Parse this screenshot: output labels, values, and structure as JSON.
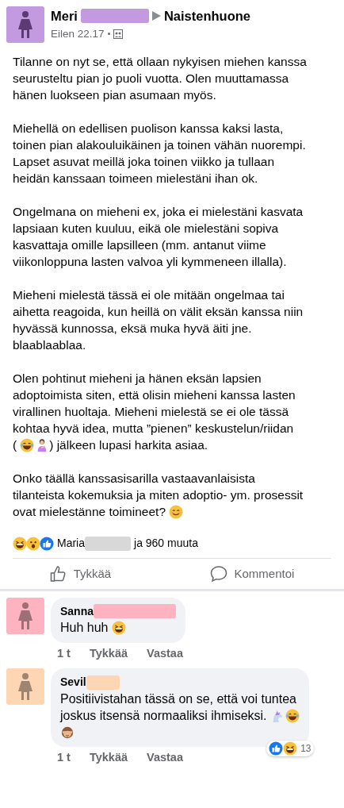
{
  "post": {
    "author": "Meri",
    "group": "Naistenhuone",
    "time": "Eilen 22.17",
    "paragraphs": [
      [
        [
          {
            "kind": "text",
            "text": "Tilanne on nyt se, että ollaan nykyisen miehen kanssa"
          }
        ],
        [
          {
            "kind": "text",
            "text": "seurusteltu pian jo puoli vuotta. Olen muuttamassa"
          }
        ],
        [
          {
            "kind": "text",
            "text": "hänen luokseen pian asumaan myös."
          }
        ]
      ],
      [
        [
          {
            "kind": "text",
            "text": "Miehellä on edellisen puolison kanssa kaksi lasta,"
          }
        ],
        [
          {
            "kind": "text",
            "text": "toinen pian alakouluikäinen ja toinen vähän nuorempi."
          }
        ],
        [
          {
            "kind": "text",
            "text": "Lapset asuvat meillä joka toinen viikko ja tullaan"
          }
        ],
        [
          {
            "kind": "text",
            "text": "heidän kanssaan toimeen mielestäni ihan ok."
          }
        ]
      ],
      [
        [
          {
            "kind": "text",
            "text": "Ongelmana on mieheni ex, joka ei mielestäni kasvata"
          }
        ],
        [
          {
            "kind": "text",
            "text": "lapsiaan kuten kuuluu, eikä ole mielestäni sopiva"
          }
        ],
        [
          {
            "kind": "text",
            "text": "kasvattaja omille lapsilleen (mm. antanut viime"
          }
        ],
        [
          {
            "kind": "text",
            "text": "viikonloppuna lasten valvoa yli kymmeneen illalla)."
          }
        ]
      ],
      [
        [
          {
            "kind": "text",
            "text": "Mieheni mielestä tässä ei ole mitään ongelmaa tai"
          }
        ],
        [
          {
            "kind": "text",
            "text": "aihetta reagoida, kun heillä on välit eksän kanssa niin"
          }
        ],
        [
          {
            "kind": "text",
            "text": "hyvässä kunnossa, eksä muka hyvä äiti jne."
          }
        ],
        [
          {
            "kind": "text",
            "text": "blaablaablaa."
          }
        ]
      ],
      [
        [
          {
            "kind": "text",
            "text": "Olen pohtinut mieheni ja hänen eksän lapsien"
          }
        ],
        [
          {
            "kind": "text",
            "text": "adoptoimista siten, että olisin mieheni kanssa lasten"
          }
        ],
        [
          {
            "kind": "text",
            "text": "virallinen huoltaja. Mieheni mielestä se ei ole tässä"
          }
        ],
        [
          {
            "kind": "text",
            "text": "kohtaa hyvä idea, mutta ”pienen” keskustelun/riidan"
          }
        ],
        [
          {
            "kind": "text",
            "text": "("
          },
          {
            "kind": "tears"
          },
          {
            "kind": "woman"
          },
          {
            "kind": "text",
            "text": ") jälkeen lupasi harkita asiaa."
          }
        ]
      ],
      [
        [
          {
            "kind": "text",
            "text": "Onko täällä kanssasisarilla vastaavanlaisista"
          }
        ],
        [
          {
            "kind": "text",
            "text": "tilanteista kokemuksia ja miten adoptio- ym. prosessit"
          }
        ],
        [
          {
            "kind": "text",
            "text": "ovat mielestänne toimineet?"
          },
          {
            "kind": "smile"
          }
        ]
      ]
    ]
  },
  "reactions": {
    "icons": [
      {
        "kind": "grin"
      },
      {
        "kind": "wow"
      },
      {
        "kind": "like"
      }
    ],
    "first_name": "Maria",
    "rest": "ja 960 muuta"
  },
  "actions": [
    {
      "kind": "like",
      "label": "Tykkää"
    },
    {
      "kind": "comment",
      "label": "Kommentoi"
    }
  ],
  "comments": [
    {
      "name": "Sanna",
      "color": "#ffb3c0",
      "lines": [
        [
          {
            "kind": "text",
            "text": "Huh huh"
          },
          {
            "kind": "grin"
          }
        ]
      ],
      "time": "1 t",
      "like": "Tykkää",
      "reply": "Vastaa"
    },
    {
      "name": "Sevil",
      "color": "#ffd6b3",
      "lines": [
        [
          {
            "kind": "text",
            "text": "Positiivistahan tässä on se, että voi tuntea"
          }
        ],
        [
          {
            "kind": "text",
            "text": "joskus itsensä normaaliksi ihmiseksi."
          },
          {
            "kind": "unicorn"
          },
          {
            "kind": "tears"
          }
        ],
        [
          {
            "kind": "monkey"
          }
        ]
      ],
      "time": "1 t",
      "like": "Tykkää",
      "reply": "Vastaa",
      "reaction_count": "13"
    }
  ]
}
